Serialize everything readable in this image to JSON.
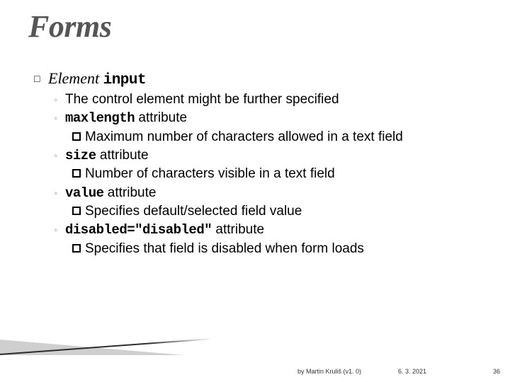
{
  "title": "Forms",
  "heading": {
    "prefix": "Element ",
    "code": "input"
  },
  "bullets": [
    {
      "type": "plain",
      "text": "The control element might be further specified"
    },
    {
      "type": "attr",
      "code": "maxlength",
      "suffix": " attribute",
      "sub": "Maximum number of characters allowed in a text field"
    },
    {
      "type": "attr",
      "code": "size",
      "suffix": " attribute",
      "sub": "Number of characters visible in a text field"
    },
    {
      "type": "attr",
      "code": "value",
      "suffix": " attribute",
      "sub": "Specifies default/selected field value"
    },
    {
      "type": "attr",
      "code": "disabled=\"disabled\"",
      "suffix": " attribute",
      "sub": "Specifies that field is disabled when form loads"
    }
  ],
  "footer": {
    "author": "by Martin Kruliš (v1. 0)",
    "date": "6. 3. 2021",
    "page": "36"
  }
}
